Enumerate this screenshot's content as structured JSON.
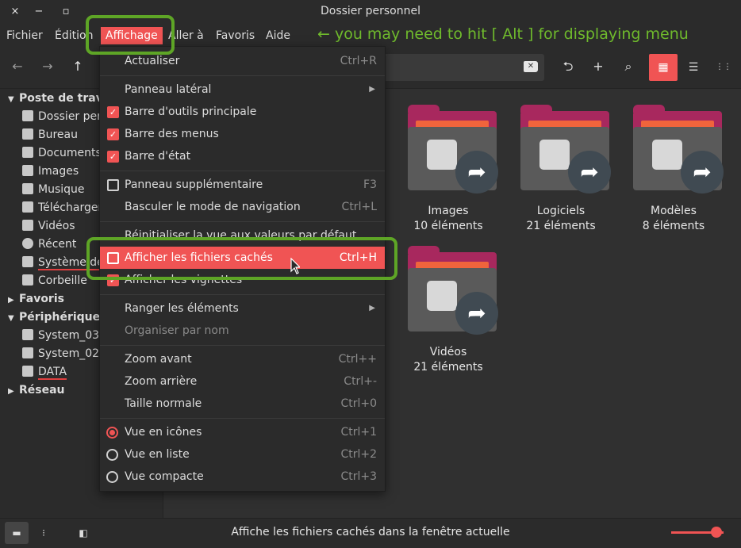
{
  "window": {
    "title": "Dossier personnel",
    "close_icon": "×",
    "minimize_icon": "−",
    "maximize_icon": "▫"
  },
  "menubar": {
    "items": [
      "Fichier",
      "Édition",
      "Affichage",
      "Aller à",
      "Favoris",
      "Aide"
    ],
    "active": "Affichage",
    "hint": "← you may need to hit [ Alt ] for displaying menu"
  },
  "toolbar": {
    "back_icon": "←",
    "forward_icon": "→",
    "up_icon": "↑",
    "clear_icon": "✕",
    "reload_icon": "⮌",
    "new_folder_icon": "+",
    "search_icon": "⌕",
    "grid_view_icon": "▦",
    "list_view_icon": "☰",
    "compact_view_icon": "⋮⋮"
  },
  "sidebar": {
    "sections": [
      {
        "title": "Poste de travail",
        "expanded": true,
        "items": [
          "Dossier personnel",
          "Bureau",
          "Documents",
          "Images",
          "Musique",
          "Téléchargements",
          "Vidéos",
          "Récent",
          "Système de fichiers",
          "Corbeille"
        ]
      },
      {
        "title": "Favoris",
        "expanded": false,
        "items": []
      },
      {
        "title": "Périphériques",
        "expanded": true,
        "items": [
          "System_03",
          "System_02",
          "DATA"
        ]
      },
      {
        "title": "Réseau",
        "expanded": false,
        "items": []
      }
    ]
  },
  "folders": [
    {
      "name": "Images",
      "count": "10 éléments"
    },
    {
      "name": "Logiciels",
      "count": "21 éléments"
    },
    {
      "name": "Modèles",
      "count": "8 éléments"
    },
    {
      "name": "Vidéos",
      "count": "21 éléments"
    }
  ],
  "menu": {
    "items": [
      {
        "label": "Actualiser",
        "shortcut": "Ctrl+R"
      },
      {
        "label": "Panneau latéral",
        "submenu": "▶"
      },
      {
        "label": "Barre d'outils principale",
        "checked": true
      },
      {
        "label": "Barre des menus",
        "checked": true
      },
      {
        "label": "Barre d'état",
        "checked": true
      },
      {
        "label": "Panneau supplémentaire",
        "shortcut": "F3",
        "checked": false
      },
      {
        "label": "Basculer le mode de navigation",
        "shortcut": "Ctrl+L"
      },
      {
        "label": "Réinitialiser la vue aux valeurs par défaut"
      },
      {
        "label": "Afficher les fichiers cachés",
        "shortcut": "Ctrl+H",
        "checked": false,
        "highlighted": true
      },
      {
        "label": "Afficher les vignettes",
        "checked": true
      },
      {
        "label": "Ranger les éléments",
        "submenu": "▶"
      },
      {
        "label": "Organiser par nom",
        "disabled": true
      },
      {
        "label": "Zoom avant",
        "shortcut": "Ctrl++"
      },
      {
        "label": "Zoom arrière",
        "shortcut": "Ctrl+-"
      },
      {
        "label": "Taille normale",
        "shortcut": "Ctrl+0"
      },
      {
        "label": "Vue en icônes",
        "shortcut": "Ctrl+1",
        "radio": true,
        "selected": true
      },
      {
        "label": "Vue en liste",
        "shortcut": "Ctrl+2",
        "radio": true
      },
      {
        "label": "Vue compacte",
        "shortcut": "Ctrl+3",
        "radio": true
      }
    ]
  },
  "statusbar": {
    "text": "Affiche les fichiers cachés dans la fenêtre actuelle",
    "places_icon": "▬",
    "tree_icon": "⁝",
    "hide_sidebar_icon": "◧",
    "zoom_level": 1.0
  },
  "colors": {
    "accent": "#f05454",
    "annotation": "#5ea526",
    "folder_back": "#a8285e",
    "folder_paper": "#f0643c",
    "folder_front": "#5a5a5a"
  }
}
